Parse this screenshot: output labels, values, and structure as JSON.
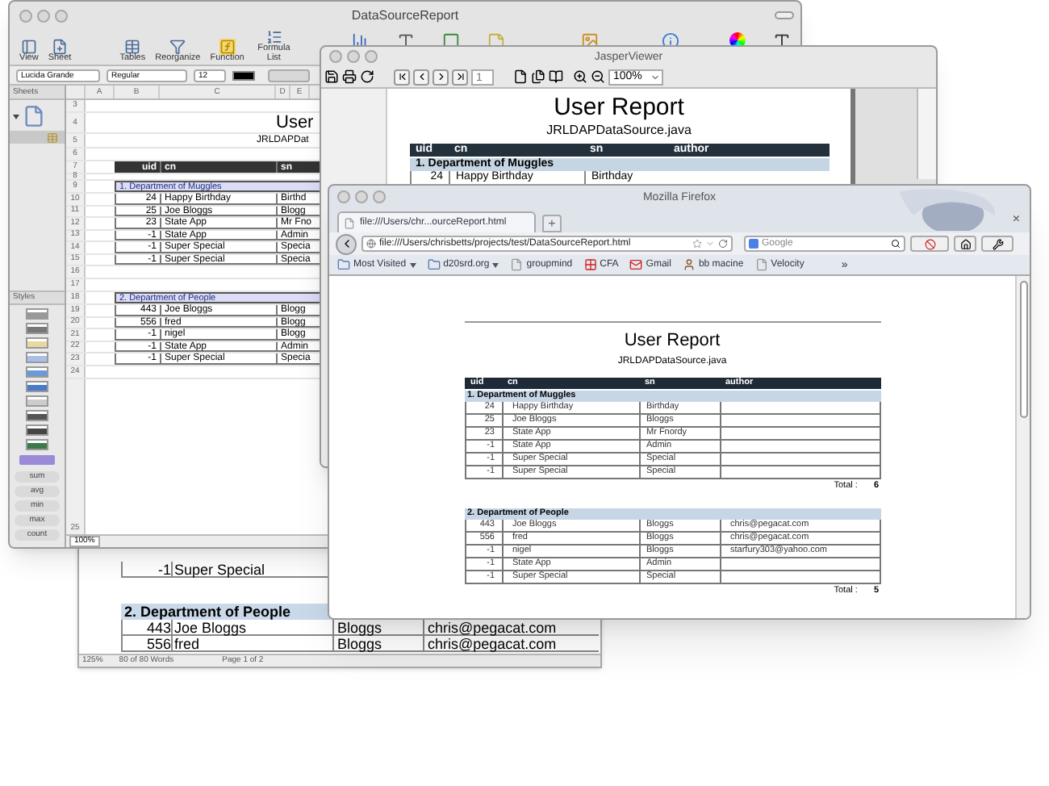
{
  "numbers": {
    "title": "DataSourceReport",
    "toolbar": [
      "View",
      "Sheet",
      "Tables",
      "Reorganize",
      "Function",
      "Formula List"
    ],
    "format": {
      "font": "Lucida Grande",
      "style": "Regular",
      "size": "12"
    },
    "sheets_label": "Sheets",
    "styles_label": "Styles",
    "columns": [
      "A",
      "B",
      "C",
      "D",
      "E"
    ],
    "rows": [
      {
        "num": "3",
        "kind": "blank"
      },
      {
        "num": "4",
        "kind": "title",
        "text": "User"
      },
      {
        "num": "5",
        "kind": "subtitle",
        "text": "JRLDAPDat"
      },
      {
        "num": "6",
        "kind": "blank"
      },
      {
        "num": "7",
        "kind": "header",
        "uid": "uid",
        "cn": "cn",
        "sn": "sn"
      },
      {
        "num": "8",
        "kind": "gap"
      },
      {
        "num": "9",
        "kind": "group",
        "text": "1. Department of Muggles"
      },
      {
        "num": "10",
        "kind": "data",
        "uid": "24",
        "cn": "Happy Birthday",
        "sn": "Birthd"
      },
      {
        "num": "11",
        "kind": "data",
        "uid": "25",
        "cn": "Joe Bloggs",
        "sn": "Blogg"
      },
      {
        "num": "12",
        "kind": "data",
        "uid": "23",
        "cn": "State App",
        "sn": "Mr Fno"
      },
      {
        "num": "13",
        "kind": "data",
        "uid": "-1",
        "cn": "State App",
        "sn": "Admin"
      },
      {
        "num": "14",
        "kind": "data",
        "uid": "-1",
        "cn": "Super Special",
        "sn": "Specia"
      },
      {
        "num": "15",
        "kind": "data",
        "uid": "-1",
        "cn": "Super Special",
        "sn": "Specia"
      },
      {
        "num": "16",
        "kind": "blank"
      },
      {
        "num": "17",
        "kind": "blank"
      },
      {
        "num": "18",
        "kind": "group",
        "text": "2. Department of People"
      },
      {
        "num": "19",
        "kind": "data",
        "uid": "443",
        "cn": "Joe Bloggs",
        "sn": "Blogg"
      },
      {
        "num": "20",
        "kind": "data",
        "uid": "556",
        "cn": "fred",
        "sn": "Blogg"
      },
      {
        "num": "21",
        "kind": "data",
        "uid": "-1",
        "cn": "nigel",
        "sn": "Blogg"
      },
      {
        "num": "22",
        "kind": "data",
        "uid": "-1",
        "cn": "State App",
        "sn": "Admin"
      },
      {
        "num": "23",
        "kind": "data",
        "uid": "-1",
        "cn": "Super Special",
        "sn": "Specia"
      },
      {
        "num": "24",
        "kind": "blank"
      }
    ],
    "last_row": "25",
    "functions": [
      "sum",
      "avg",
      "min",
      "max",
      "count"
    ],
    "zoom": "100%"
  },
  "pages": {
    "rows": [
      {
        "kind": "data",
        "uid": "-1",
        "cn": "Super Special"
      },
      {
        "kind": "group",
        "text": "2. Department of People"
      },
      {
        "kind": "data",
        "uid": "443",
        "cn": "Joe Bloggs",
        "sn": "Bloggs",
        "author": "chris@pegacat.com"
      },
      {
        "kind": "data",
        "uid": "556",
        "cn": "fred",
        "sn": "Bloggs",
        "author": "chris@pegacat.com"
      }
    ],
    "status": {
      "zoom": "125%",
      "words": "80 of 80 Words",
      "page": "Page 1 of 2"
    }
  },
  "jasper": {
    "title": "JasperViewer",
    "page": "1",
    "zoom": "100%",
    "report": {
      "title": "User Report",
      "subtitle": "JRLDAPDataSource.java",
      "columns": [
        "uid",
        "cn",
        "sn",
        "author"
      ],
      "group": "1. Department of Muggles",
      "row": {
        "uid": "24",
        "cn": "Happy Birthday",
        "sn": "Birthday"
      }
    }
  },
  "firefox": {
    "title": "Mozilla Firefox",
    "tab": "file:///Users/chr...ourceReport.html",
    "new_tab": "+",
    "close_tab": "×",
    "url": "file:///Users/chrisbetts/projects/test/DataSourceReport.html",
    "search": {
      "placeholder": "Google"
    },
    "bookmarks": [
      {
        "label": "Most Visited",
        "kind": "folder",
        "dropdown": true
      },
      {
        "label": "d20srd.org",
        "kind": "folder",
        "dropdown": true
      },
      {
        "label": "groupmind",
        "kind": "page",
        "dropdown": false
      },
      {
        "label": "CFA",
        "kind": "checker",
        "dropdown": false
      },
      {
        "label": "Gmail",
        "kind": "mail",
        "dropdown": false
      },
      {
        "label": "bb macine",
        "kind": "person",
        "dropdown": false
      },
      {
        "label": "Velocity",
        "kind": "page",
        "dropdown": false
      }
    ],
    "more": "»",
    "report": {
      "title": "User Report",
      "subtitle": "JRLDAPDataSource.java",
      "columns": [
        "uid",
        "cn",
        "sn",
        "author"
      ],
      "groups": [
        {
          "name": "1. Department of Muggles",
          "total_label": "Total :",
          "total": "6",
          "rows": [
            {
              "uid": "24",
              "cn": "Happy Birthday",
              "sn": "Birthday"
            },
            {
              "uid": "25",
              "cn": "Joe Bloggs",
              "sn": "Bloggs"
            },
            {
              "uid": "23",
              "cn": "State App",
              "sn": "Mr Fnordy"
            },
            {
              "uid": "-1",
              "cn": "State App",
              "sn": "Admin"
            },
            {
              "uid": "-1",
              "cn": "Super Special",
              "sn": "Special"
            },
            {
              "uid": "-1",
              "cn": "Super Special",
              "sn": "Special"
            }
          ]
        },
        {
          "name": "2. Department of People",
          "total_label": "Total :",
          "total": "5",
          "rows": [
            {
              "uid": "443",
              "cn": "Joe Bloggs",
              "sn": "Bloggs",
              "author": "chris@pegacat.com"
            },
            {
              "uid": "556",
              "cn": "fred",
              "sn": "Bloggs",
              "author": "chris@pegacat.com"
            },
            {
              "uid": "-1",
              "cn": "nigel",
              "sn": "Bloggs",
              "author": "starfury303@yahoo.com"
            },
            {
              "uid": "-1",
              "cn": "State App",
              "sn": "Admin"
            },
            {
              "uid": "-1",
              "cn": "Super Special",
              "sn": "Special"
            }
          ]
        }
      ]
    }
  }
}
